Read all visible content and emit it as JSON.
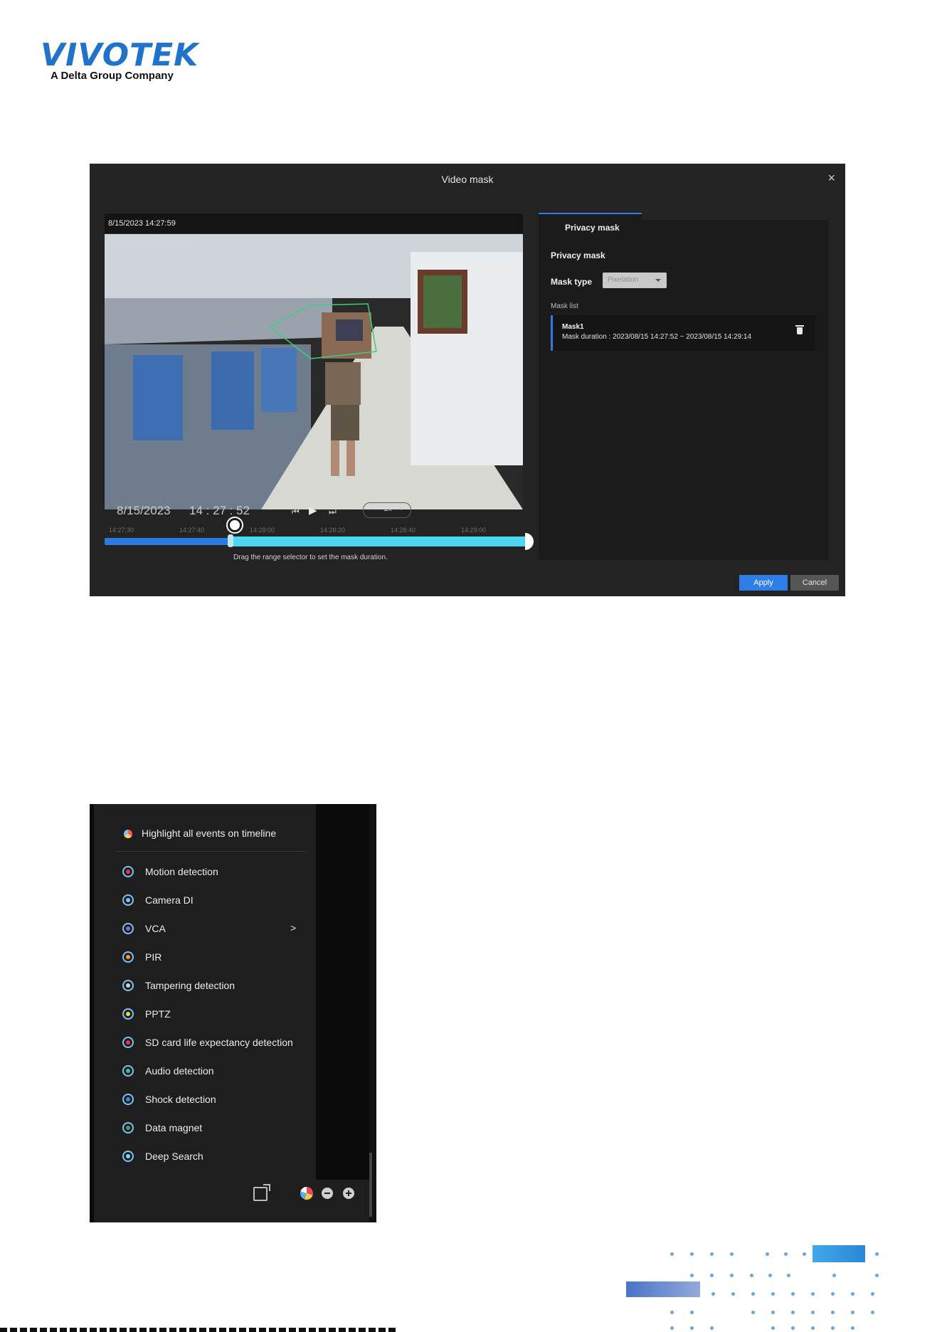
{
  "logo": {
    "word": "VIVOTEK",
    "tagline": "A Delta Group Company"
  },
  "video_mask": {
    "title": "Video mask",
    "close": "×",
    "stamp": "8/15/2023 14:27:59",
    "osd": "2023/08/15 14:27:59",
    "date": "8/15/2023",
    "time": "14 : 27 : 52",
    "speed": {
      "minus": "−",
      "value": "1x",
      "plus": "+"
    },
    "ticks": [
      "14:27:30",
      "14:27:40",
      "14:28:00",
      "14:28:20",
      "14:28:40",
      "14:29:00"
    ],
    "range_start_fraction": 0.29,
    "hint": "Drag the range selector to set the mask duration.",
    "side": {
      "tab": "Privacy mask",
      "heading": "Privacy mask",
      "mask_type_label": "Mask type",
      "mask_type_value": "Pixelation",
      "mask_list_label": "Mask list",
      "items": [
        {
          "name": "Mask1",
          "duration": "Mask duration : 2023/08/15 14:27:52 ~ 2023/08/15 14:29:14"
        }
      ]
    },
    "apply": "Apply",
    "cancel": "Cancel"
  },
  "events": {
    "header": "Highlight all events on timeline",
    "items": [
      {
        "label": "Motion detection",
        "color": "#e8344e"
      },
      {
        "label": "Camera DI",
        "color": "#7fc2f2"
      },
      {
        "label": "VCA",
        "color": "#a05fd1",
        "chevron": ">"
      },
      {
        "label": "PIR",
        "color": "#f39a35"
      },
      {
        "label": "Tampering detection",
        "color": "#cfcfcf"
      },
      {
        "label": "PPTZ",
        "color": "#f6d33c"
      },
      {
        "label": "SD card life expectancy detection",
        "color": "#e8344e"
      },
      {
        "label": "Audio detection",
        "color": "#2ec4a5"
      },
      {
        "label": "Shock detection",
        "color": "#3d82e2"
      },
      {
        "label": "Data magnet",
        "color": "#3aa64d"
      },
      {
        "label": "Deep Search",
        "color": "#7ad9f6"
      }
    ]
  }
}
